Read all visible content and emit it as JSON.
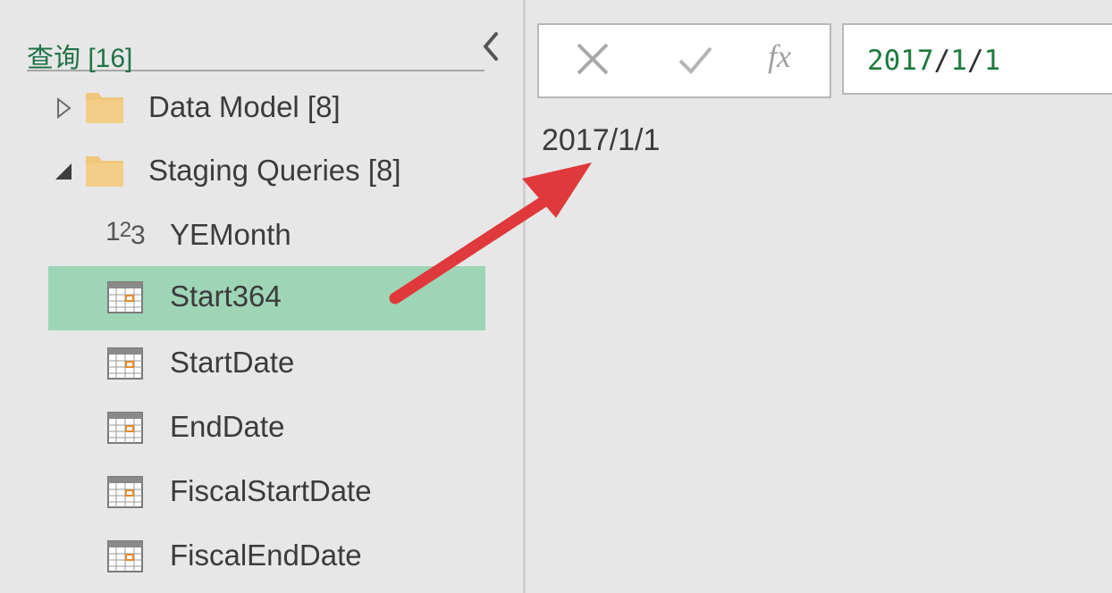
{
  "queries_pane": {
    "title": "查询 [16]",
    "collapse_icon": "chevron-left-icon",
    "groups": [
      {
        "label": "Data Model [8]",
        "expanded": false,
        "icon": "folder-icon"
      },
      {
        "label": "Staging Queries [8]",
        "expanded": true,
        "icon": "folder-icon",
        "items": [
          {
            "label": "YEMonth",
            "icon": "number-type-icon",
            "selected": false
          },
          {
            "label": "Start364",
            "icon": "table-icon",
            "selected": true
          },
          {
            "label": "StartDate",
            "icon": "table-icon",
            "selected": false
          },
          {
            "label": "EndDate",
            "icon": "table-icon",
            "selected": false
          },
          {
            "label": "FiscalStartDate",
            "icon": "table-icon",
            "selected": false
          },
          {
            "label": "FiscalEndDate",
            "icon": "table-icon",
            "selected": false
          }
        ]
      }
    ]
  },
  "formula_bar": {
    "cancel_icon": "close-icon",
    "commit_icon": "checkmark-icon",
    "fx_label": "fx",
    "formula_parts": [
      "2017",
      "/",
      "1",
      "/",
      "1"
    ]
  },
  "result": {
    "value": "2017/1/1"
  },
  "annotation": {
    "icon": "red-arrow-icon"
  },
  "colors": {
    "pane_background": "#e7e7e7",
    "accent_green": "#217346",
    "selected_row": "#9fd5b7",
    "arrow_red": "#e0393b",
    "folder": "#f0c77c"
  }
}
